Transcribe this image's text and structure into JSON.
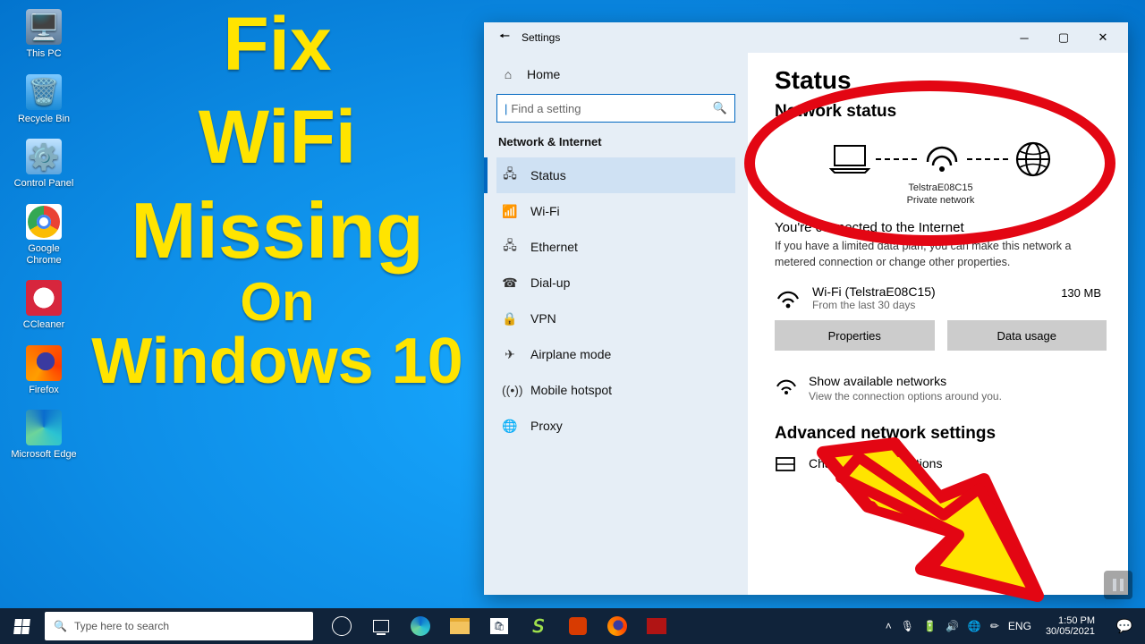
{
  "desktop_icons": {
    "this_pc": "This PC",
    "recycle_bin": "Recycle Bin",
    "control_panel": "Control Panel",
    "chrome": "Google Chrome",
    "ccleaner": "CCleaner",
    "firefox": "Firefox",
    "edge": "Microsoft Edge"
  },
  "headline": {
    "l1": "Fix",
    "l2": "WiFi",
    "l3": "Missing",
    "l4": "On",
    "l5": "Windows 10"
  },
  "settings": {
    "window_title": "Settings",
    "home": "Home",
    "search_placeholder": "Find a setting",
    "category": "Network & Internet",
    "nav": {
      "status": "Status",
      "wifi": "Wi-Fi",
      "ethernet": "Ethernet",
      "dialup": "Dial-up",
      "vpn": "VPN",
      "airplane": "Airplane mode",
      "hotspot": "Mobile hotspot",
      "proxy": "Proxy"
    },
    "page_title": "Status",
    "section_title": "Network status",
    "diagram": {
      "ssid": "TelstraE08C15",
      "type": "Private network"
    },
    "connected_title": "You're connected to the Internet",
    "connected_body": "If you have a limited data plan, you can make this network a metered connection or change other properties.",
    "usage": {
      "adapter": "Wi-Fi (TelstraE08C15)",
      "period": "From the last 30 days",
      "amount": "130 MB"
    },
    "btn_properties": "Properties",
    "btn_datausage": "Data usage",
    "available": {
      "title": "Show available networks",
      "sub": "View the connection options around you."
    },
    "advanced_title": "Advanced network settings",
    "change_adapter": "Change adapter options"
  },
  "taskbar": {
    "search_placeholder": "Type here to search",
    "lang": "ENG",
    "time": "1:50 PM",
    "date": "30/05/2021"
  }
}
